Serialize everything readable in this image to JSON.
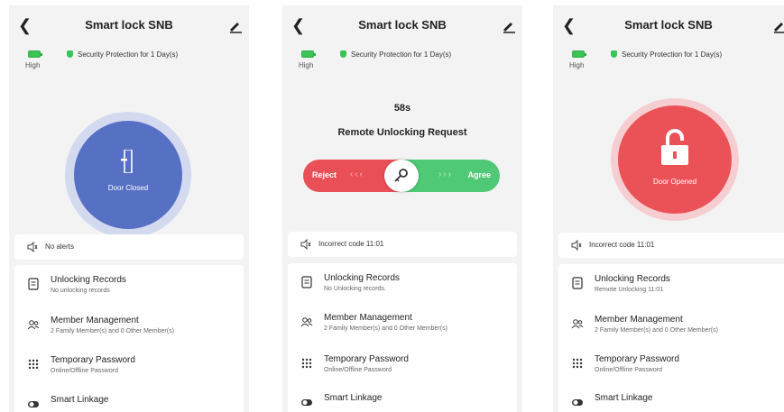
{
  "app": {
    "title": "Smart lock SNB"
  },
  "colors": {
    "green": "#3bc455",
    "blue": "#5670c4",
    "red": "#e94f56",
    "agree": "#4fc975"
  },
  "screens": [
    {
      "battery_level": "High",
      "security": "Security Protection for 1 Day(s)",
      "door_status": "Door Closed",
      "alert": "No alerts",
      "menu": [
        {
          "label": "Unlocking Records",
          "sub": "No unlocking records",
          "icon": "records-icon"
        },
        {
          "label": "Member Management",
          "sub": "2 Family Member(s) and 0 Other Member(s)",
          "icon": "members-icon"
        },
        {
          "label": "Temporary Password",
          "sub": "Online/Offline Password",
          "icon": "keypad-icon"
        },
        {
          "label": "Smart Linkage",
          "sub": "",
          "icon": "toggle-icon"
        }
      ]
    },
    {
      "battery_level": "High",
      "security": "Security Protection for 1 Day(s)",
      "timer": "58s",
      "request_title": "Remote Unlocking Request",
      "reject_label": "Reject",
      "agree_label": "Agree",
      "alert": "Incorrect code 11:01",
      "menu": [
        {
          "label": "Unlocking Records",
          "sub": "No Unlocking records.",
          "icon": "records-icon"
        },
        {
          "label": "Member Management",
          "sub": "2 Family Member(s) and 0 Other Member(s)",
          "icon": "members-icon"
        },
        {
          "label": "Temporary Password",
          "sub": "Online/Offline Password",
          "icon": "keypad-icon"
        },
        {
          "label": "Smart Linkage",
          "sub": "",
          "icon": "toggle-icon"
        }
      ]
    },
    {
      "battery_level": "High",
      "security": "Security Protection for 1 Day(s)",
      "door_status": "Door Opened",
      "alert": "Incorrect code 11:01",
      "menu": [
        {
          "label": "Unlocking Records",
          "sub": "Remote Unlocking 11:01",
          "icon": "records-icon"
        },
        {
          "label": "Member Management",
          "sub": "2 Family Member(s) and 0 Other Member(s)",
          "icon": "members-icon"
        },
        {
          "label": "Temporary Password",
          "sub": "Online/Offline Password",
          "icon": "keypad-icon"
        },
        {
          "label": "Smart Linkage",
          "sub": "",
          "icon": "toggle-icon"
        }
      ]
    }
  ]
}
